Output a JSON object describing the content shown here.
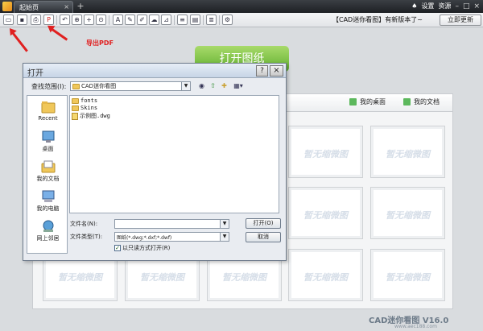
{
  "titlebar": {
    "tab_label": "起始页",
    "tab_close": "×",
    "new_tab": "+",
    "settings": "设置",
    "resources": "资源",
    "minimize": "–",
    "maximize": "□",
    "close": "×"
  },
  "toolbar": {
    "notice": "【CAD迷你看图】有新版本了~",
    "update_button": "立即更新"
  },
  "annotation": {
    "pdf_label": "导出PDF"
  },
  "main": {
    "open_button": "打开图纸",
    "tabs": [
      "我的桌面",
      "我的文档"
    ],
    "thumbnail_placeholder": "暂无缩微图",
    "brand": "CAD迷你看图 V16.0",
    "brand_url": "www.aec188.com"
  },
  "dialog": {
    "title": "打开",
    "help": "?",
    "close": "×",
    "look_in_label": "查找范围(I):",
    "look_in_value": "CAD迷你看图",
    "places": [
      "Recent",
      "桌面",
      "我的文档",
      "我的电脑",
      "网上邻居"
    ],
    "files": [
      {
        "name": "fonts",
        "type": "folder"
      },
      {
        "name": "Skins",
        "type": "folder"
      },
      {
        "name": "示例图.dwg",
        "type": "dwg"
      }
    ],
    "filename_label": "文件名(N):",
    "filename_value": "",
    "filetype_label": "文件类型(T):",
    "filetype_value": "图纸(*.dwg;*.dxf;*.dwf)",
    "open_button": "打开(O)",
    "cancel_button": "取消",
    "readonly_label": "以只读方式打开(R)",
    "readonly_checked": "✓"
  },
  "colors": {
    "accent_red": "#e02020",
    "open_green": "#6fbf3a"
  }
}
